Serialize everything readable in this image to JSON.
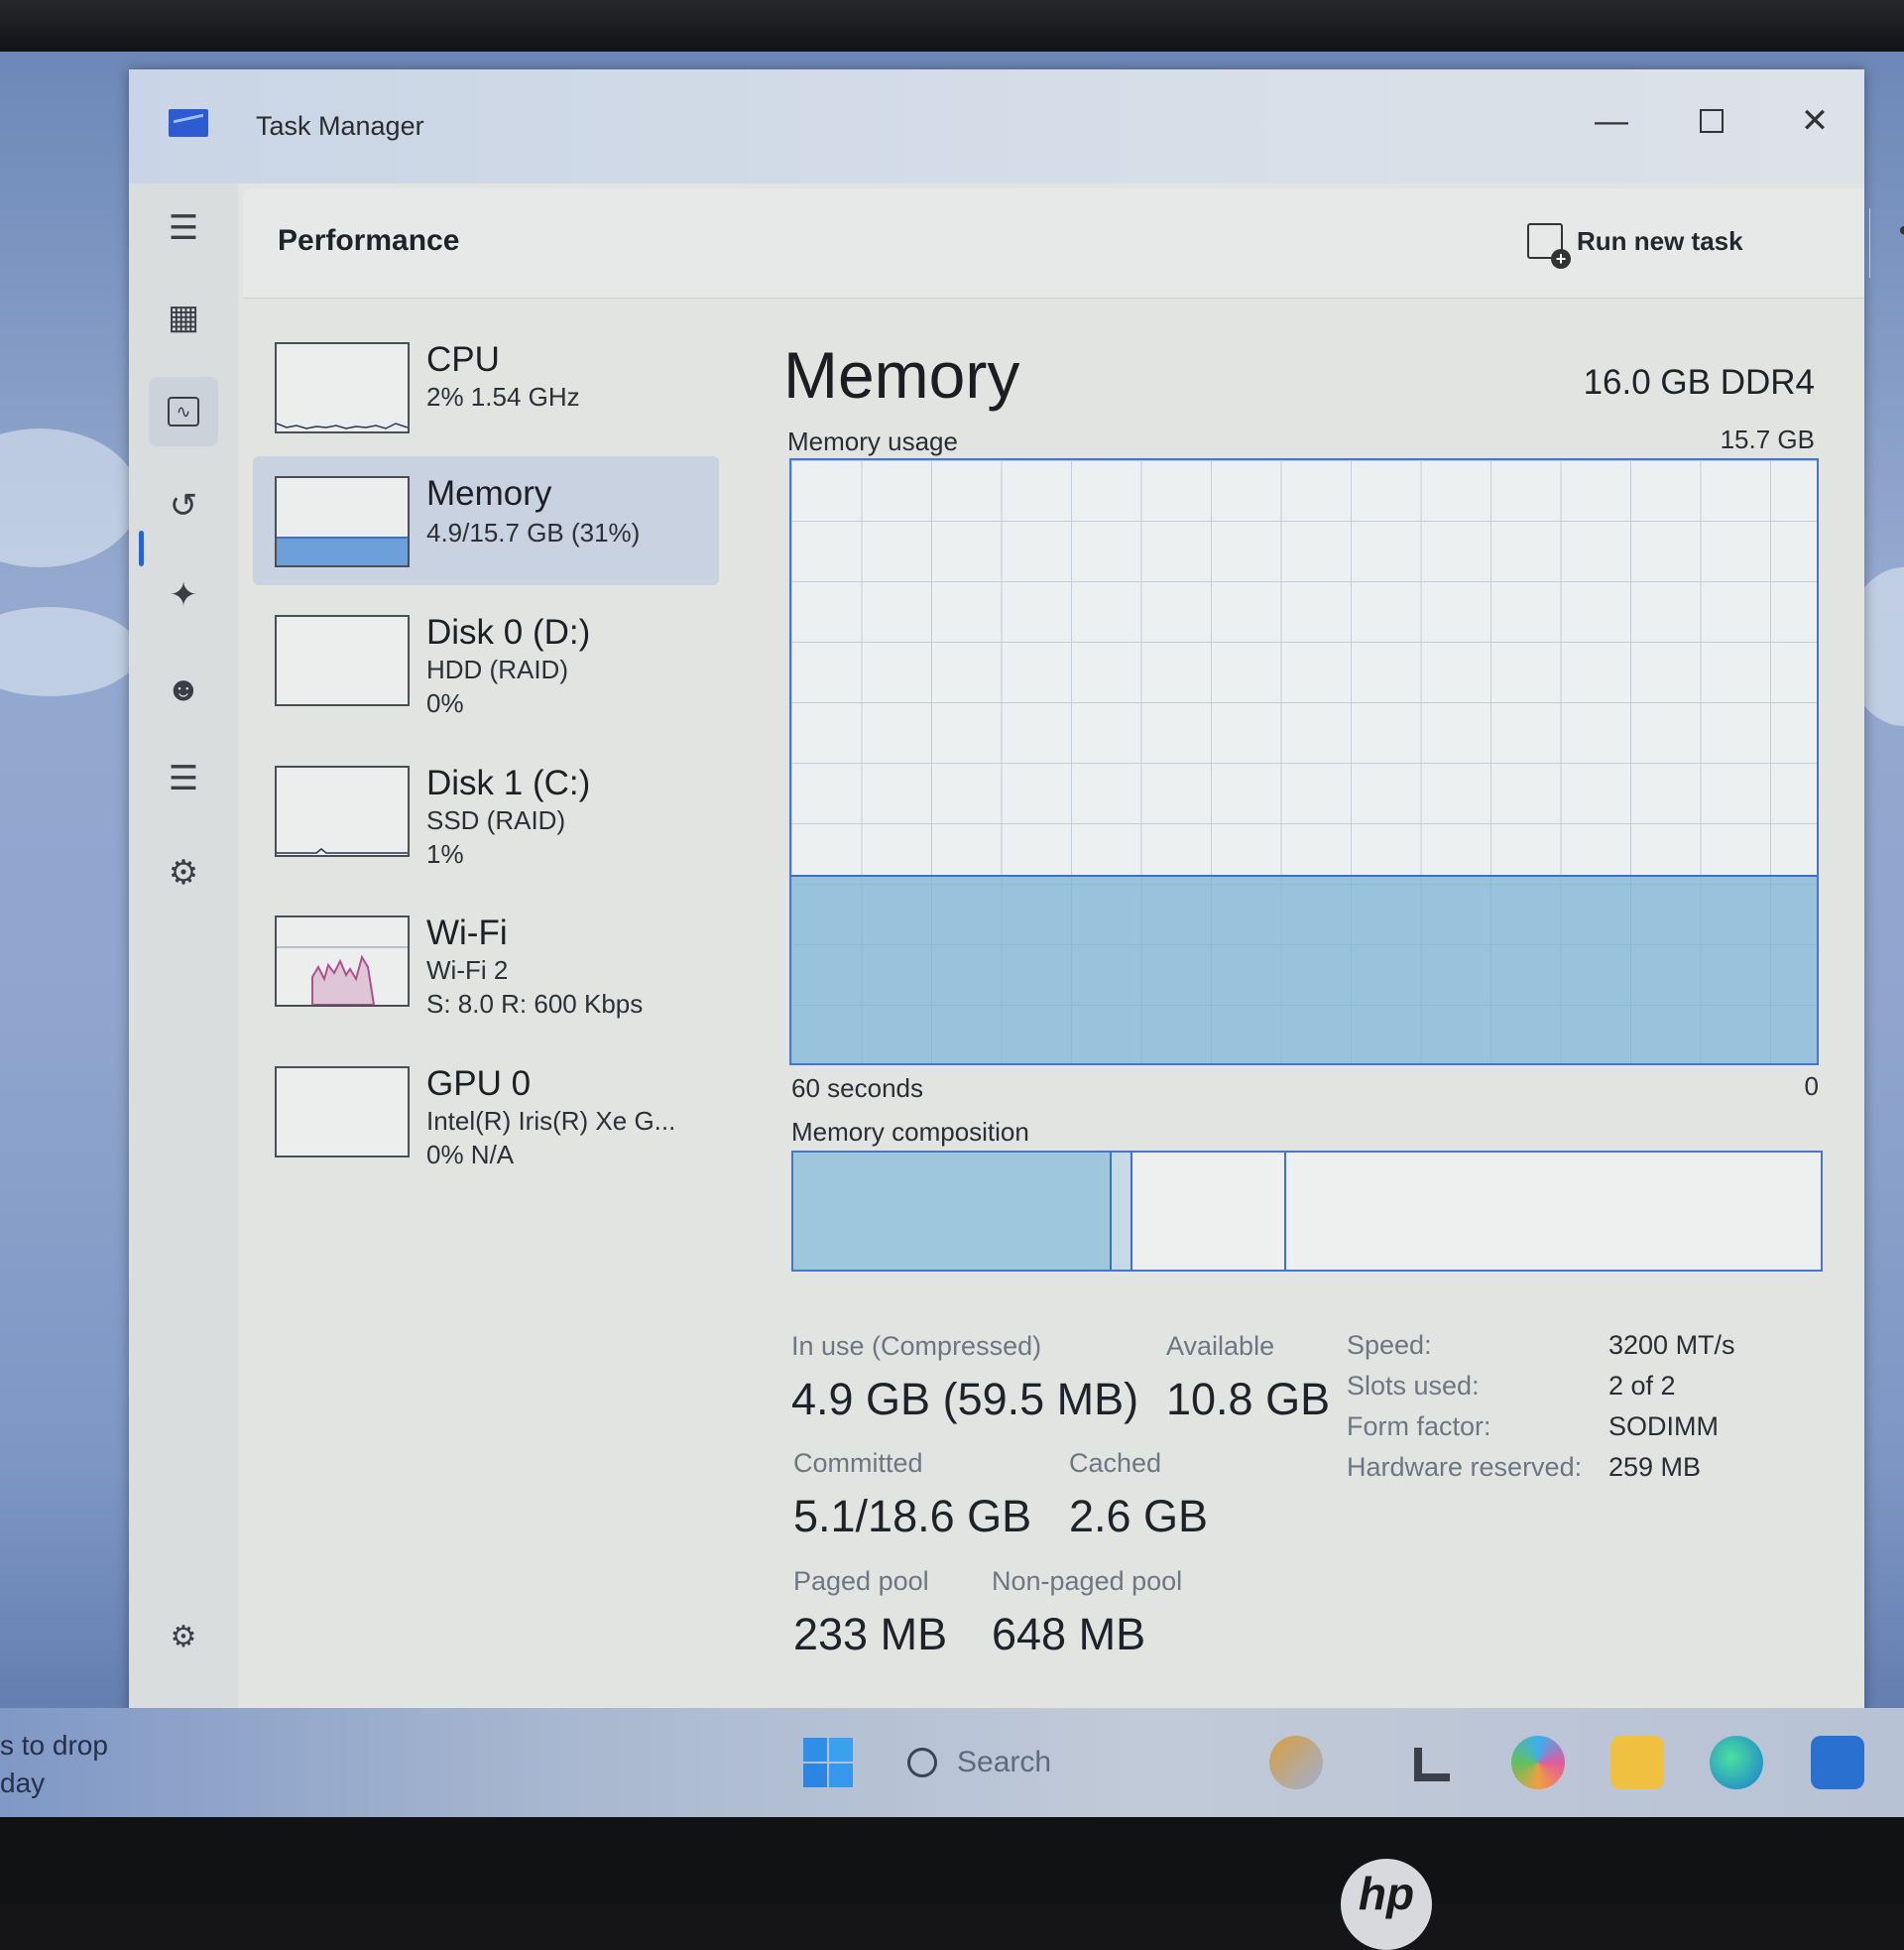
{
  "window": {
    "title": "Task Manager"
  },
  "header": {
    "page_title": "Performance",
    "run_task_label": "Run new task",
    "more_label": "•••"
  },
  "sidebar": {
    "items": [
      {
        "icon": "hamburger-icon"
      },
      {
        "icon": "processes-icon"
      },
      {
        "icon": "performance-icon",
        "active": true
      },
      {
        "icon": "app-history-icon"
      },
      {
        "icon": "startup-apps-icon"
      },
      {
        "icon": "users-icon"
      },
      {
        "icon": "details-icon"
      },
      {
        "icon": "services-icon"
      },
      {
        "icon": "settings-icon"
      }
    ]
  },
  "devices": [
    {
      "name": "CPU",
      "line1": "2% 1.54 GHz",
      "line2": ""
    },
    {
      "name": "Memory",
      "line1": "4.9/15.7 GB (31%)",
      "line2": "",
      "selected": true,
      "fill_fraction": 0.31
    },
    {
      "name": "Disk 0 (D:)",
      "line1": "HDD (RAID)",
      "line2": "0%"
    },
    {
      "name": "Disk 1 (C:)",
      "line1": "SSD (RAID)",
      "line2": "1%"
    },
    {
      "name": "Wi-Fi",
      "line1": "Wi-Fi 2",
      "line2": "S: 8.0 R: 600 Kbps"
    },
    {
      "name": "GPU 0",
      "line1": "Intel(R) Iris(R) Xe G...",
      "line2": "0% N/A"
    }
  ],
  "detail": {
    "title": "Memory",
    "spec": "16.0 GB DDR4",
    "usage_label": "Memory usage",
    "usage_max": "15.7 GB",
    "usage_fraction": 0.31,
    "time_start": "60 seconds",
    "time_end": "0",
    "composition_label": "Memory composition",
    "composition_fractions": {
      "in_use": 0.31,
      "modified": 0.02,
      "standby": 0.15
    },
    "stats": {
      "in_use_label": "In use (Compressed)",
      "in_use_value": "4.9 GB (59.5 MB)",
      "available_label": "Available",
      "available_value": "10.8 GB",
      "committed_label": "Committed",
      "committed_value": "5.1/18.6 GB",
      "cached_label": "Cached",
      "cached_value": "2.6 GB",
      "paged_label": "Paged pool",
      "paged_value": "233 MB",
      "nonpaged_label": "Non-paged pool",
      "nonpaged_value": "648 MB"
    },
    "specs": [
      {
        "key": "Speed:",
        "value": "3200 MT/s"
      },
      {
        "key": "Slots used:",
        "value": "2 of 2"
      },
      {
        "key": "Form factor:",
        "value": "SODIMM"
      },
      {
        "key": "Hardware reserved:",
        "value": "259 MB"
      }
    ]
  },
  "taskbar": {
    "notification_line1": "s to drop",
    "notification_line2": "day",
    "search_placeholder": "Search"
  },
  "colors": {
    "accent": "#3d6fd0",
    "memory_fill": "#7cb3d4",
    "wifi_graph": "#b0508f"
  }
}
